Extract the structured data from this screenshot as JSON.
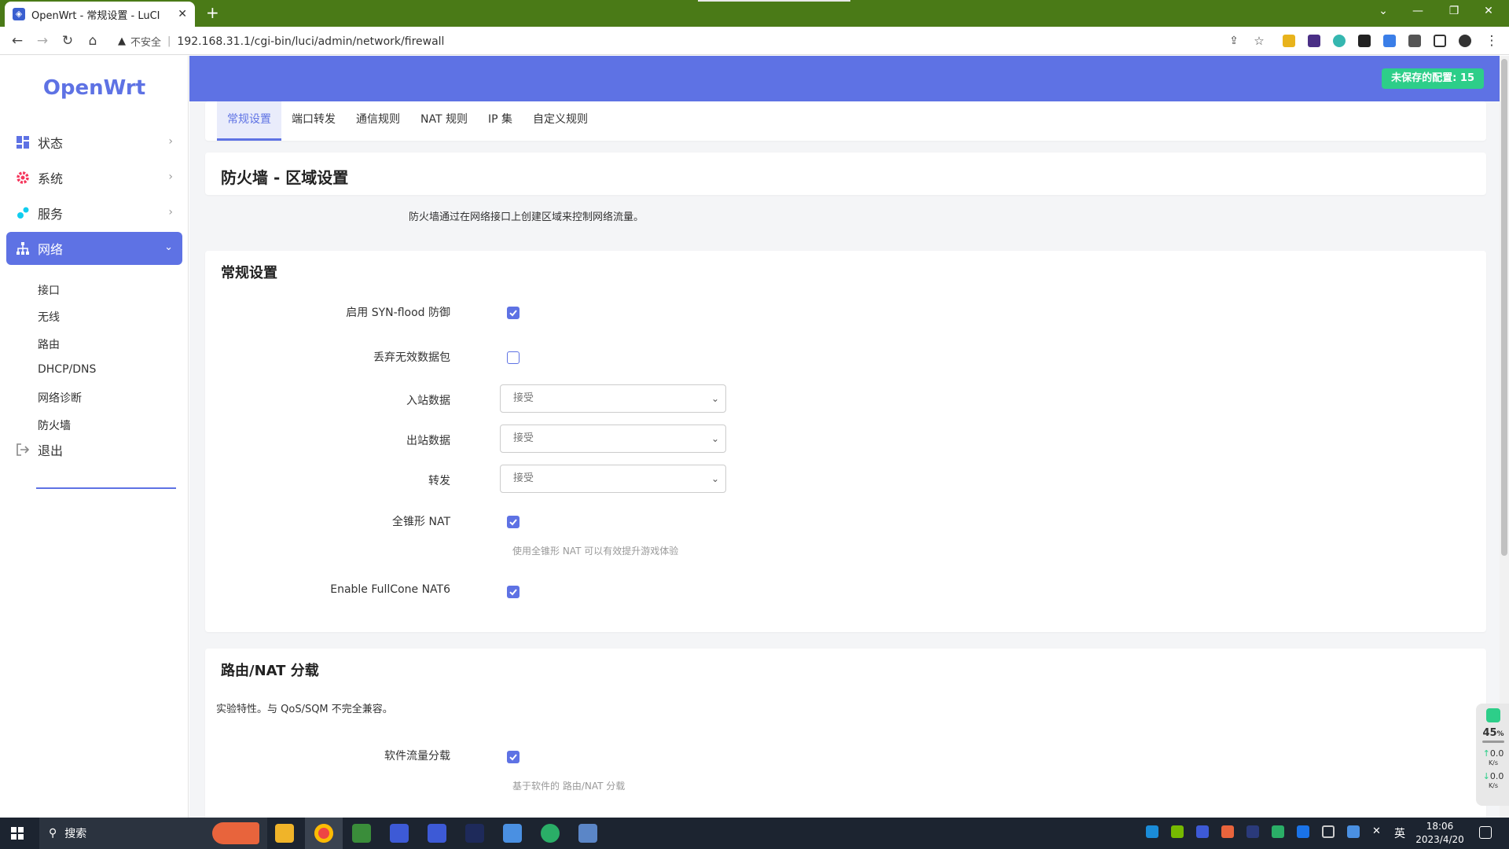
{
  "browser": {
    "tab_title": "OpenWrt - 常规设置 - LuCI",
    "tab_close": "✕",
    "new_tab": "+",
    "security_label": "不安全",
    "url": "192.168.31.1/cgi-bin/luci/admin/network/firewall"
  },
  "sidebar": {
    "logo": "OpenWrt",
    "menu": [
      {
        "label": "状态"
      },
      {
        "label": "系统"
      },
      {
        "label": "服务"
      },
      {
        "label": "网络"
      }
    ],
    "submenu": [
      "接口",
      "无线",
      "路由",
      "DHCP/DNS",
      "网络诊断",
      "防火墙"
    ],
    "logout": "退出"
  },
  "header": {
    "unsaved": "未保存的配置: 15"
  },
  "tabs": [
    "常规设置",
    "端口转发",
    "通信规则",
    "NAT 规则",
    "IP 集",
    "自定义规则"
  ],
  "page": {
    "title": "防火墙 - 区域设置",
    "description": "防火墙通过在网络接口上创建区域来控制网络流量。"
  },
  "general": {
    "title": "常规设置",
    "syn_flood_label": "启用 SYN-flood 防御",
    "syn_flood_checked": true,
    "drop_invalid_label": "丢弃无效数据包",
    "drop_invalid_checked": false,
    "input_label": "入站数据",
    "input_value": "接受",
    "output_label": "出站数据",
    "output_value": "接受",
    "forward_label": "转发",
    "forward_value": "接受",
    "fullcone_label": "全锥形 NAT",
    "fullcone_checked": true,
    "fullcone_hint": "使用全锥形 NAT 可以有效提升游戏体验",
    "fullcone6_label": "Enable FullCone NAT6",
    "fullcone6_checked": true
  },
  "offload": {
    "title": "路由/NAT 分载",
    "description": "实验特性。与 QoS/SQM 不完全兼容。",
    "sw_offload_label": "软件流量分载",
    "sw_offload_checked": true,
    "sw_offload_hint": "基于软件的 路由/NAT 分载"
  },
  "widget": {
    "percent": "45",
    "percent_unit": "%",
    "up": "0.0",
    "up_unit": "K/s",
    "down": "0.0",
    "down_unit": "K/s"
  },
  "taskbar": {
    "search_label": "搜索",
    "ime": "英",
    "time": "18:06",
    "date": "2023/4/20"
  },
  "colors": {
    "accent": "#5e72e4",
    "success": "#2dce89",
    "browser_frame": "#4a7a17",
    "taskbar": "#1c2430"
  }
}
